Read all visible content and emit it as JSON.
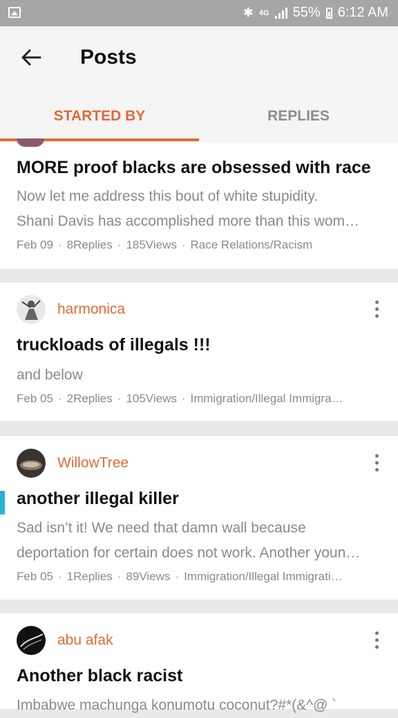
{
  "status_bar": {
    "network": "4G",
    "battery": "55%",
    "time": "6:12 AM"
  },
  "header": {
    "title": "Posts"
  },
  "tabs": [
    {
      "label": "STARTED BY"
    },
    {
      "label": "REPLIES"
    }
  ],
  "posts": [
    {
      "title": "MORE proof blacks are obsessed with race",
      "excerpt": [
        "Now let me address this bout of white stupidity.",
        "Shani Davis has accomplished more than this wom…"
      ],
      "date": "Feb 09",
      "replies": "8Replies",
      "views": "185Views",
      "category": "Race Relations/Racism"
    },
    {
      "author": "harmonica",
      "title": "truckloads of illegals !!!",
      "excerpt": [
        "and below"
      ],
      "date": "Feb 05",
      "replies": "2Replies",
      "views": "105Views",
      "category": "Immigration/Illegal Immigra…"
    },
    {
      "author": "WillowTree",
      "title": "another illegal killer",
      "excerpt": [
        "Sad isn’t it! We need that damn wall because",
        "deportation for certain does not work. Another youn…"
      ],
      "date": "Feb 05",
      "replies": "1Replies",
      "views": "89Views",
      "category": "Immigration/Illegal Immigrati…"
    },
    {
      "author": "abu afak",
      "title": "Another black racist",
      "excerpt": [
        "Imbabwe machunga konumotu coconut?#*(&^@ `"
      ]
    }
  ],
  "colors": {
    "accent": "#e06a36",
    "marker": "#25b3cf"
  }
}
